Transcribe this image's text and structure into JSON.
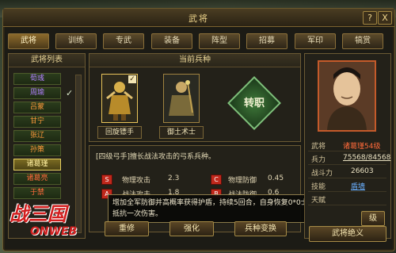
{
  "window": {
    "title": "武将",
    "help_label": "?",
    "close_label": "X"
  },
  "tabs": [
    {
      "label": "武将"
    },
    {
      "label": "训练"
    },
    {
      "label": "专武"
    },
    {
      "label": "装备"
    },
    {
      "label": "阵型"
    },
    {
      "label": "招募"
    },
    {
      "label": "军印"
    },
    {
      "label": "犒赏"
    }
  ],
  "general_list": {
    "title": "武将列表",
    "items": [
      {
        "label": "荀彧"
      },
      {
        "label": "周瑜"
      },
      {
        "label": "吕蒙"
      },
      {
        "label": "甘宁"
      },
      {
        "label": "张辽"
      },
      {
        "label": "孙策"
      },
      {
        "label": "诸葛瑾"
      },
      {
        "label": "诸葛亮"
      },
      {
        "label": "于禁"
      }
    ],
    "selected_index": 6
  },
  "troops": {
    "title": "当前兵种",
    "items": [
      {
        "label": "回旋镖手",
        "checked": true
      },
      {
        "label": "御土术士",
        "checked": false
      }
    ],
    "change_label": "转职"
  },
  "troop_desc": "[四级弓手]擅长战法攻击的弓系兵种。",
  "stats": [
    {
      "grade": "S",
      "name": "物理攻击",
      "value": "2.3"
    },
    {
      "grade": "C",
      "name": "物理防御",
      "value": "0.45"
    },
    {
      "grade": "A",
      "name": "战法攻击",
      "value": "1.8"
    },
    {
      "grade": "B",
      "name": "战法防御",
      "value": "0.6"
    }
  ],
  "tooltip": "增加全军防御并高概率获得护盾，持续5回合，自身恢复0*0士气。护盾可以抵抗一次伤害。",
  "buttons": {
    "reset": "重修",
    "strengthen": "强化",
    "change_troop": "兵种变换",
    "general_skill": "武将绝义",
    "partial": "级"
  },
  "general_info": {
    "rows": [
      {
        "key": "武将",
        "value": "诸葛瑾54级"
      },
      {
        "key": "兵力",
        "value": "75568/84568"
      },
      {
        "key": "战斗力",
        "value": "26603"
      },
      {
        "key": "技能",
        "value": "盾墙"
      },
      {
        "key": "天赋",
        "value": ""
      }
    ]
  },
  "logo": {
    "main": "战三国",
    "sub": "ONWEB"
  },
  "colors": {
    "accent": "#e5c76b",
    "grade_red": "#c0281c",
    "link_blue": "#6ab0ff"
  }
}
